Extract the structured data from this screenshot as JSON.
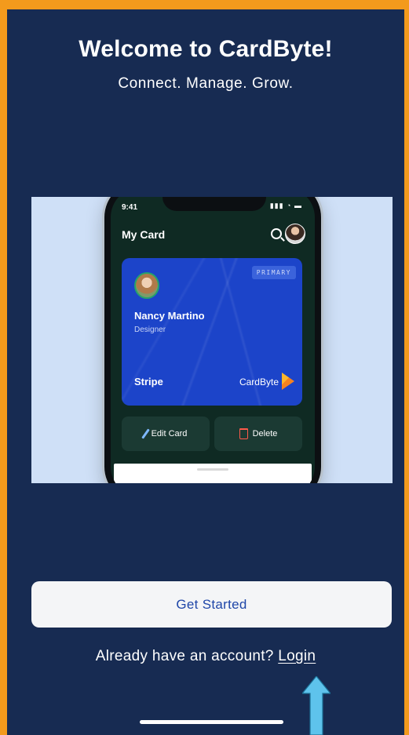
{
  "welcome": {
    "title": "Welcome to CardByte!",
    "tagline": "Connect. Manage. Grow."
  },
  "preview": {
    "status_time": "9:41",
    "status_icons": "▮▮▮ ◔ ▬",
    "screen_title": "My Card",
    "card": {
      "badge": "PRIMARY",
      "name": "Nancy Martino",
      "role": "Designer",
      "company": "Stripe",
      "brand": "CardByte"
    },
    "edit_label": "Edit Card",
    "delete_label": "Delete"
  },
  "actions": {
    "get_started": "Get Started",
    "login_prompt": "Already have an account?",
    "login_link": "Login"
  },
  "colors": {
    "background": "#172b52",
    "frame": "#f39a1c",
    "card": "#1c44c9",
    "button_text": "#1f46a8",
    "arrow": "#5ec3ec"
  }
}
